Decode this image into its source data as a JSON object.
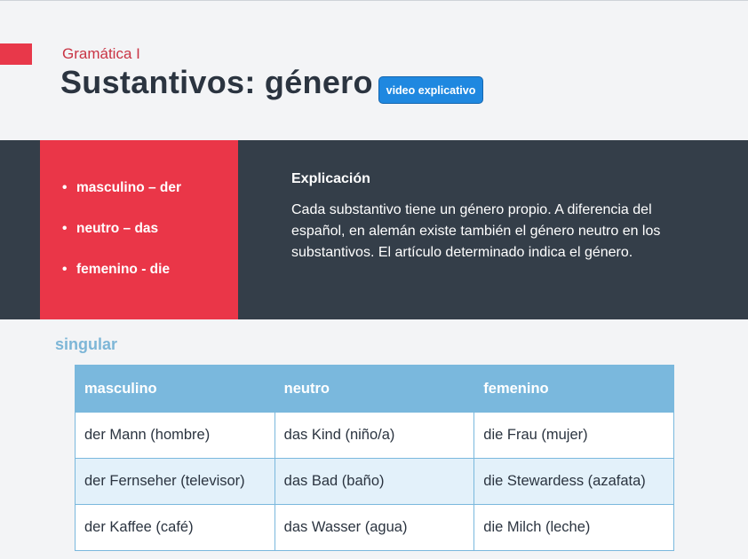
{
  "header": {
    "subtitle": "Gramática I",
    "title": "Sustantivos: género",
    "video_button": "video explicativo"
  },
  "genders": [
    {
      "label": "masculino – der"
    },
    {
      "label": "neutro – das"
    },
    {
      "label": "femenino - die"
    }
  ],
  "explanation": {
    "heading": "Explicación",
    "text": "Cada substantivo tiene un género propio. A diferencia del español, en alemán existe también el género neutro en los substantivos. El artículo determinado indica el género."
  },
  "section_label": "singular",
  "table": {
    "headers": [
      "masculino",
      "neutro",
      "femenino"
    ],
    "rows": [
      [
        "der Mann (hombre)",
        "das Kind (niño/a)",
        "die Frau (mujer)"
      ],
      [
        "der Fernseher (televisor)",
        "das Bad (baño)",
        "die Stewardess (azafata)"
      ],
      [
        "der Kaffee (café)",
        "das Wasser (agua)",
        "die Milch (leche)"
      ]
    ]
  },
  "colors": {
    "accent_red": "#ea3648",
    "dark_band": "#343e49",
    "table_header": "#7ab8dd",
    "button_blue": "#1f88e0"
  }
}
